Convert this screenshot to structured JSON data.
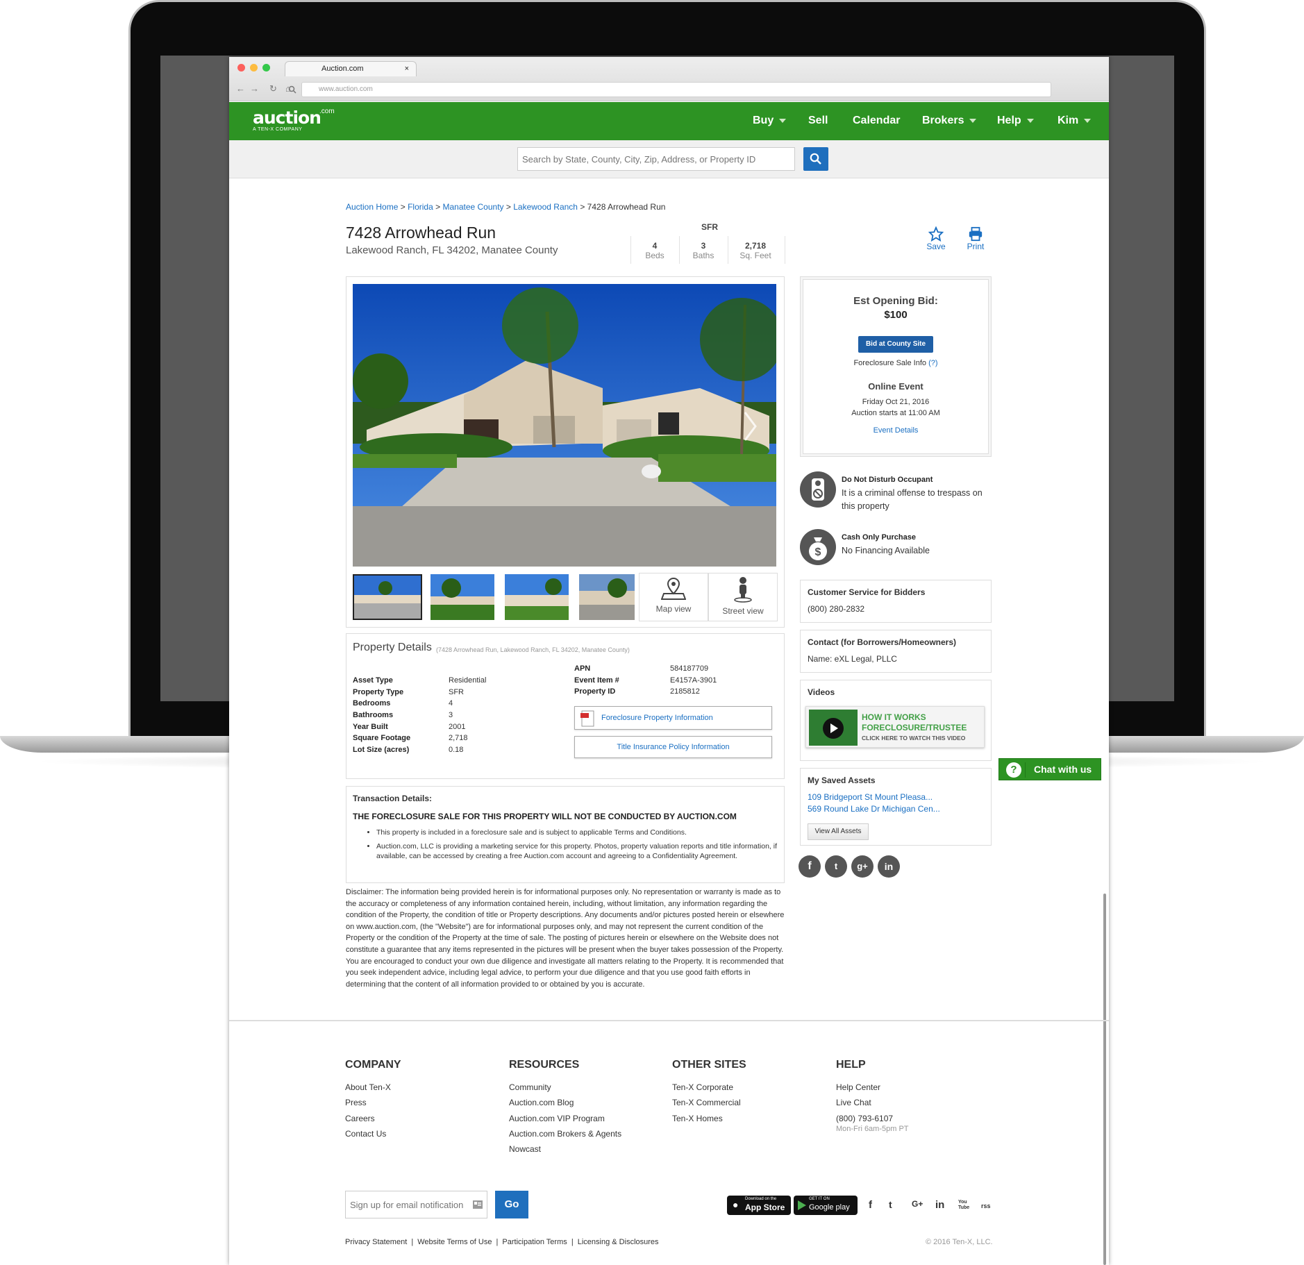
{
  "browser": {
    "tab_title": "Auction.com",
    "tab_close": "×",
    "url": "www.auction.com"
  },
  "site": {
    "logo_text": "auction",
    "logo_suffix": ".com",
    "logo_tagline": "A TEN-X COMPANY",
    "accent_color": "#2d9323",
    "nav": [
      {
        "label": "Buy",
        "dropdown": true
      },
      {
        "label": "Sell",
        "dropdown": false
      },
      {
        "label": "Calendar",
        "dropdown": false
      },
      {
        "label": "Brokers",
        "dropdown": true
      },
      {
        "label": "Help",
        "dropdown": true
      },
      {
        "label": "Kim",
        "dropdown": true
      }
    ],
    "search_placeholder": "Search by State, County, City, Zip, Address, or Property ID"
  },
  "breadcrumb": {
    "items": [
      "Auction Home",
      "Florida",
      "Manatee County",
      "Lakewood Ranch"
    ],
    "current": "7428 Arrowhead Run",
    "separator": ">"
  },
  "property": {
    "title": "7428 Arrowhead Run",
    "address": "Lakewood Ranch, FL 34202, Manatee County",
    "type": "SFR",
    "stats": [
      {
        "value": "4",
        "label": "Beds"
      },
      {
        "value": "3",
        "label": "Baths"
      },
      {
        "value": "2,718",
        "label": "Sq. Feet"
      }
    ],
    "actions": {
      "save": "Save",
      "print": "Print"
    },
    "media": {
      "map": "Map view",
      "street": "Street view"
    }
  },
  "bid_box": {
    "label": "Est Opening Bid:",
    "amount": "$100",
    "button": "Bid at County Site",
    "foreclosure_info": "Foreclosure Sale Info",
    "help": "(?)",
    "event_title": "Online Event",
    "event_date": "Friday Oct 21, 2016",
    "event_time": "Auction starts at 11:00 AM",
    "event_link": "Event Details"
  },
  "notices": [
    {
      "title": "Do Not Disturb Occupant",
      "text": "It is a criminal offense to trespass on this property"
    },
    {
      "title": "Cash Only Purchase",
      "text": "No Financing Available"
    }
  ],
  "customer_service": {
    "title": "Customer Service for Bidders",
    "phone": "(800) 280-2832"
  },
  "contact": {
    "title": "Contact (for Borrowers/Homeowners)",
    "name": "Name: eXL Legal, PLLC"
  },
  "videos": {
    "title": "Videos",
    "line1": "HOW IT WORKS",
    "line2": "FORECLOSURE/TRUSTEE",
    "line3": "CLICK HERE TO WATCH THIS VIDEO"
  },
  "chat": "Chat with us",
  "saved_assets": {
    "title": "My Saved Assets",
    "items": [
      "109 Bridgeport St Mount Pleasa...",
      "569 Round Lake Dr Michigan Cen..."
    ],
    "button": "View All Assets"
  },
  "share_icons": [
    "f",
    "t",
    "g+",
    "in"
  ],
  "details": {
    "title": "Property Details",
    "subtitle": "(7428 Arrowhead Run, Lakewood Ranch, FL 34202, Manatee County)",
    "left": [
      {
        "k": "Asset Type",
        "v": "Residential"
      },
      {
        "k": "Property Type",
        "v": "SFR"
      },
      {
        "k": "Bedrooms",
        "v": "4"
      },
      {
        "k": "Bathrooms",
        "v": "3"
      },
      {
        "k": "Year Built",
        "v": "2001"
      },
      {
        "k": "Square Footage",
        "v": "2,718"
      },
      {
        "k": "Lot Size (acres)",
        "v": "0.18"
      }
    ],
    "right": [
      {
        "k": "APN",
        "v": "584187709"
      },
      {
        "k": "Event Item #",
        "v": "E4157A-3901"
      },
      {
        "k": "Property ID",
        "v": "2185812"
      }
    ],
    "doc1": "Foreclosure Property Information",
    "doc2": "Title Insurance Policy Information"
  },
  "transaction": {
    "title": "Transaction Details:",
    "headline": "THE FORECLOSURE SALE FOR THIS PROPERTY WILL NOT BE CONDUCTED BY AUCTION.COM",
    "bullets": [
      "This property is included in a foreclosure sale and is subject to applicable Terms and Conditions.",
      "Auction.com, LLC is providing a marketing service for this property. Photos, property valuation reports and title information, if available, can be accessed by creating a free Auction.com account and agreeing to a Confidentiality Agreement."
    ]
  },
  "disclaimer": "Disclaimer: The information being provided herein is for informational purposes only. No representation or warranty is made as to the accuracy or completeness of any information contained herein, including, without limitation, any information regarding the condition of the Property, the condition of title or Property descriptions. Any documents and/or pictures posted herein or elsewhere on www.auction.com, (the \"Website\") are for informational purposes only, and may not represent the current condition of the Property or the condition of the Property at the time of sale. The posting of pictures herein or elsewhere on the Website does not constitute a guarantee that any items represented in the pictures will be present when the buyer takes possession of the Property. You are encouraged to conduct your own due diligence and investigate all matters relating to the Property. It is recommended that you seek independent advice, including legal advice, to perform your due diligence and that you use good faith efforts in determining that the content of all information provided to or obtained by you is accurate.",
  "footer": {
    "columns": [
      {
        "title": "COMPANY",
        "links": [
          "About Ten-X",
          "Press",
          "Careers",
          "Contact Us"
        ]
      },
      {
        "title": "RESOURCES",
        "links": [
          "Community",
          "Auction.com Blog",
          "Auction.com VIP Program",
          "Auction.com Brokers & Agents",
          "Nowcast"
        ]
      },
      {
        "title": "OTHER SITES",
        "links": [
          "Ten-X Corporate",
          "Ten-X Commercial",
          "Ten-X Homes"
        ]
      },
      {
        "title": "HELP",
        "links": [
          "Help Center",
          "Live Chat",
          "(800) 793-6107"
        ],
        "hours": "Mon-Fri 6am-5pm PT"
      }
    ],
    "email_placeholder": "Sign up for email notifications",
    "go": "Go",
    "app_store_small": "Download on the",
    "app_store": "App Store",
    "google_small": "GET IT ON",
    "google": "Google play",
    "social": [
      "f",
      "t",
      "G+",
      "in",
      "You Tube",
      "rss"
    ],
    "legal": [
      "Privacy Statement",
      "Website Terms of Use",
      "Participation Terms",
      "Licensing & Disclosures"
    ],
    "copyright": "© 2016 Ten-X, LLC."
  }
}
